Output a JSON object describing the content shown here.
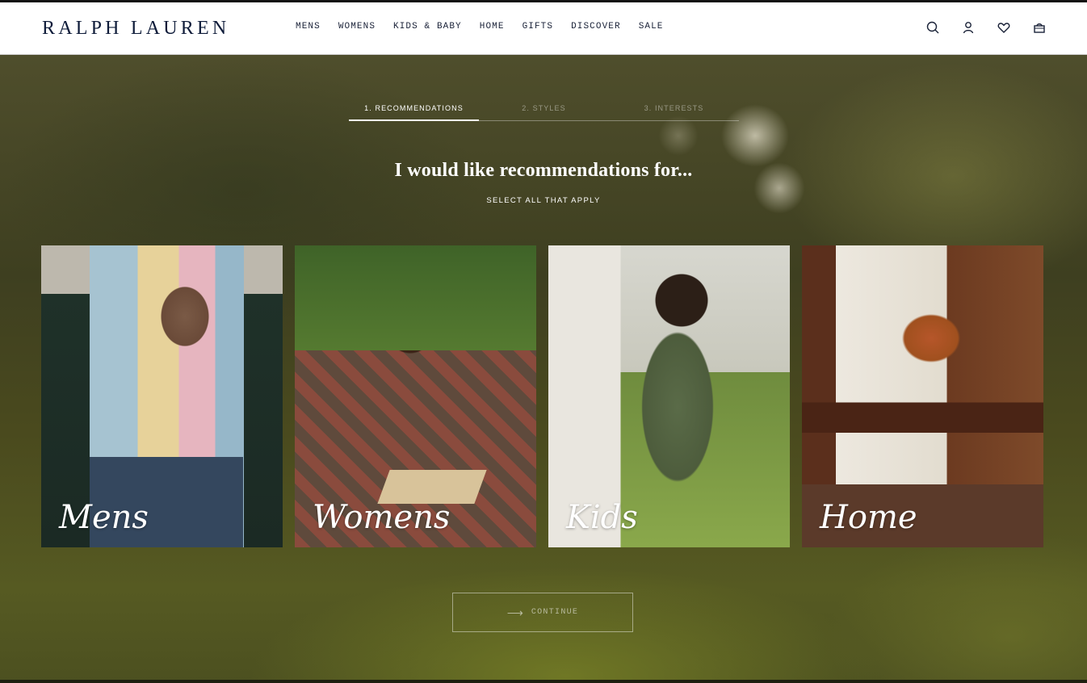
{
  "header": {
    "logo": "RALPH LAUREN",
    "nav": [
      "MENS",
      "WOMENS",
      "KIDS & BABY",
      "HOME",
      "GIFTS",
      "DISCOVER",
      "SALE"
    ],
    "icons": [
      "search-icon",
      "account-icon",
      "heart-icon",
      "shopping-bag-icon"
    ]
  },
  "steps": [
    {
      "label": "1. RECOMMENDATIONS",
      "active": true
    },
    {
      "label": "2. STYLES",
      "active": false
    },
    {
      "label": "3. INTERESTS",
      "active": false
    }
  ],
  "main": {
    "title": "I would like recommendations for...",
    "subtitle": "SELECT ALL THAT APPLY",
    "cards": [
      "Mens",
      "Womens",
      "Kids",
      "Home"
    ],
    "continue_label": "CONTINUE"
  }
}
